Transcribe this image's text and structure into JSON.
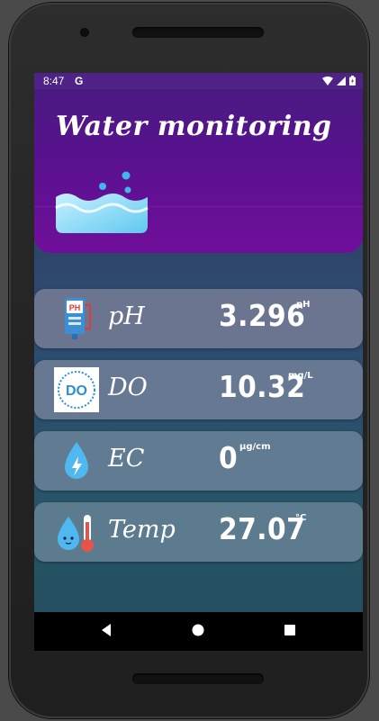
{
  "status_bar": {
    "time": "8:47",
    "notification": "G",
    "icons": [
      "wifi-icon",
      "cellular-icon",
      "battery-icon"
    ]
  },
  "header": {
    "title": "Water monitoring",
    "icon": "water-tank-icon"
  },
  "sensors": [
    {
      "label": "pH",
      "value": "3.296",
      "unit": "pH",
      "icon": "ph-meter-icon"
    },
    {
      "label": "DO",
      "value": "10.32",
      "unit": "mg/L",
      "icon": "do-badge-icon",
      "icon_text": "DO"
    },
    {
      "label": "EC",
      "value": "0",
      "unit": "µg/cm",
      "icon": "water-drop-bolt-icon"
    },
    {
      "label": "Temp",
      "value": "27.07",
      "unit": "°C",
      "icon": "thermometer-drop-icon"
    }
  ],
  "nav_bar": {
    "buttons": [
      "back-icon",
      "home-icon",
      "recents-icon"
    ]
  },
  "colors": {
    "header_gradient_top": "#4a1a82",
    "header_gradient_bottom": "#700f9a",
    "card_ph": "#6c7590",
    "card_do": "#677992",
    "card_ec": "#617b92",
    "card_temp": "#5c7b8f",
    "water_light": "#b8ecff",
    "water_dark": "#4fc7f2"
  }
}
